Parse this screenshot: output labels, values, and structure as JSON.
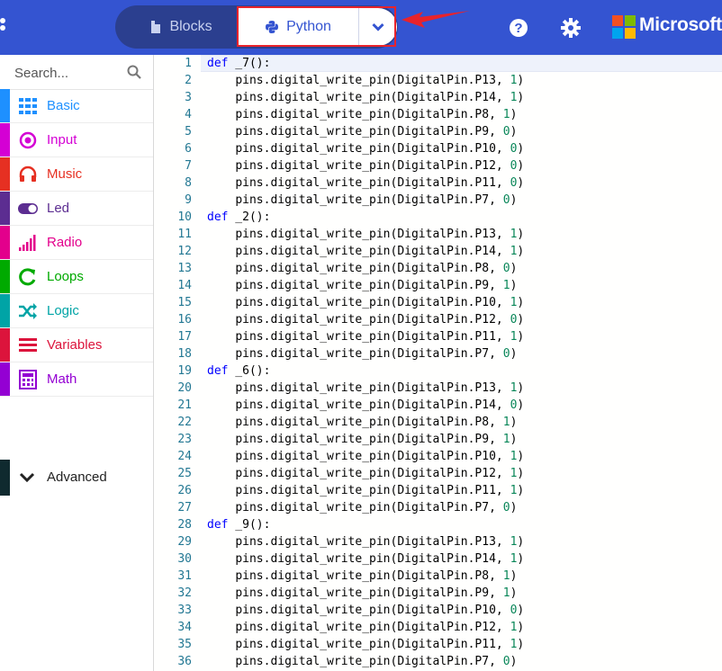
{
  "topbar": {
    "blocks_label": "Blocks",
    "python_label": "Python",
    "brand": "Microsoft",
    "colors": {
      "bar": "#3454d1",
      "highlight": "#e8232b"
    },
    "icons": [
      "blocks-icon",
      "python-icon",
      "chevron-down-icon",
      "help-icon",
      "gear-icon",
      "microsoft-logo"
    ]
  },
  "sidebar": {
    "search_placeholder": "Search...",
    "categories": [
      {
        "label": "Basic",
        "color": "#1e90ff",
        "icon": "grid-icon"
      },
      {
        "label": "Input",
        "color": "#d400d4",
        "icon": "target-icon"
      },
      {
        "label": "Music",
        "color": "#e63022",
        "icon": "headphones-icon"
      },
      {
        "label": "Led",
        "color": "#5c2d91",
        "icon": "toggle-icon"
      },
      {
        "label": "Radio",
        "color": "#e3008c",
        "icon": "signal-icon"
      },
      {
        "label": "Loops",
        "color": "#00aa00",
        "icon": "refresh-icon"
      },
      {
        "label": "Logic",
        "color": "#00a4a6",
        "icon": "shuffle-icon"
      },
      {
        "label": "Variables",
        "color": "#dc143c",
        "icon": "list-icon"
      },
      {
        "label": "Math",
        "color": "#9400d3",
        "icon": "calculator-icon"
      }
    ],
    "advanced_label": "Advanced"
  },
  "editor": {
    "lines": [
      {
        "n": "1",
        "kw": "def",
        "text": " _7():"
      },
      {
        "n": "2",
        "ind": "    ",
        "fn": "pins.digital_write_pin(DigitalPin.P13, ",
        "num": "1",
        "end": ")"
      },
      {
        "n": "3",
        "ind": "    ",
        "fn": "pins.digital_write_pin(DigitalPin.P14, ",
        "num": "1",
        "end": ")"
      },
      {
        "n": "4",
        "ind": "    ",
        "fn": "pins.digital_write_pin(DigitalPin.P8, ",
        "num": "1",
        "end": ")"
      },
      {
        "n": "5",
        "ind": "    ",
        "fn": "pins.digital_write_pin(DigitalPin.P9, ",
        "num": "0",
        "end": ")"
      },
      {
        "n": "6",
        "ind": "    ",
        "fn": "pins.digital_write_pin(DigitalPin.P10, ",
        "num": "0",
        "end": ")"
      },
      {
        "n": "7",
        "ind": "    ",
        "fn": "pins.digital_write_pin(DigitalPin.P12, ",
        "num": "0",
        "end": ")"
      },
      {
        "n": "8",
        "ind": "    ",
        "fn": "pins.digital_write_pin(DigitalPin.P11, ",
        "num": "0",
        "end": ")"
      },
      {
        "n": "9",
        "ind": "    ",
        "fn": "pins.digital_write_pin(DigitalPin.P7, ",
        "num": "0",
        "end": ")"
      },
      {
        "n": "10",
        "kw": "def",
        "text": " _2():"
      },
      {
        "n": "11",
        "ind": "    ",
        "fn": "pins.digital_write_pin(DigitalPin.P13, ",
        "num": "1",
        "end": ")"
      },
      {
        "n": "12",
        "ind": "    ",
        "fn": "pins.digital_write_pin(DigitalPin.P14, ",
        "num": "1",
        "end": ")"
      },
      {
        "n": "13",
        "ind": "    ",
        "fn": "pins.digital_write_pin(DigitalPin.P8, ",
        "num": "0",
        "end": ")"
      },
      {
        "n": "14",
        "ind": "    ",
        "fn": "pins.digital_write_pin(DigitalPin.P9, ",
        "num": "1",
        "end": ")"
      },
      {
        "n": "15",
        "ind": "    ",
        "fn": "pins.digital_write_pin(DigitalPin.P10, ",
        "num": "1",
        "end": ")"
      },
      {
        "n": "16",
        "ind": "    ",
        "fn": "pins.digital_write_pin(DigitalPin.P12, ",
        "num": "0",
        "end": ")"
      },
      {
        "n": "17",
        "ind": "    ",
        "fn": "pins.digital_write_pin(DigitalPin.P11, ",
        "num": "1",
        "end": ")"
      },
      {
        "n": "18",
        "ind": "    ",
        "fn": "pins.digital_write_pin(DigitalPin.P7, ",
        "num": "0",
        "end": ")"
      },
      {
        "n": "19",
        "kw": "def",
        "text": " _6():"
      },
      {
        "n": "20",
        "ind": "    ",
        "fn": "pins.digital_write_pin(DigitalPin.P13, ",
        "num": "1",
        "end": ")"
      },
      {
        "n": "21",
        "ind": "    ",
        "fn": "pins.digital_write_pin(DigitalPin.P14, ",
        "num": "0",
        "end": ")"
      },
      {
        "n": "22",
        "ind": "    ",
        "fn": "pins.digital_write_pin(DigitalPin.P8, ",
        "num": "1",
        "end": ")"
      },
      {
        "n": "23",
        "ind": "    ",
        "fn": "pins.digital_write_pin(DigitalPin.P9, ",
        "num": "1",
        "end": ")"
      },
      {
        "n": "24",
        "ind": "    ",
        "fn": "pins.digital_write_pin(DigitalPin.P10, ",
        "num": "1",
        "end": ")"
      },
      {
        "n": "25",
        "ind": "    ",
        "fn": "pins.digital_write_pin(DigitalPin.P12, ",
        "num": "1",
        "end": ")"
      },
      {
        "n": "26",
        "ind": "    ",
        "fn": "pins.digital_write_pin(DigitalPin.P11, ",
        "num": "1",
        "end": ")"
      },
      {
        "n": "27",
        "ind": "    ",
        "fn": "pins.digital_write_pin(DigitalPin.P7, ",
        "num": "0",
        "end": ")"
      },
      {
        "n": "28",
        "kw": "def",
        "text": " _9():"
      },
      {
        "n": "29",
        "ind": "    ",
        "fn": "pins.digital_write_pin(DigitalPin.P13, ",
        "num": "1",
        "end": ")"
      },
      {
        "n": "30",
        "ind": "    ",
        "fn": "pins.digital_write_pin(DigitalPin.P14, ",
        "num": "1",
        "end": ")"
      },
      {
        "n": "31",
        "ind": "    ",
        "fn": "pins.digital_write_pin(DigitalPin.P8, ",
        "num": "1",
        "end": ")"
      },
      {
        "n": "32",
        "ind": "    ",
        "fn": "pins.digital_write_pin(DigitalPin.P9, ",
        "num": "1",
        "end": ")"
      },
      {
        "n": "33",
        "ind": "    ",
        "fn": "pins.digital_write_pin(DigitalPin.P10, ",
        "num": "0",
        "end": ")"
      },
      {
        "n": "34",
        "ind": "    ",
        "fn": "pins.digital_write_pin(DigitalPin.P12, ",
        "num": "1",
        "end": ")"
      },
      {
        "n": "35",
        "ind": "    ",
        "fn": "pins.digital_write_pin(DigitalPin.P11, ",
        "num": "1",
        "end": ")"
      },
      {
        "n": "36",
        "ind": "    ",
        "fn": "pins.digital_write_pin(DigitalPin.P7, ",
        "num": "0",
        "end": ")"
      }
    ]
  }
}
